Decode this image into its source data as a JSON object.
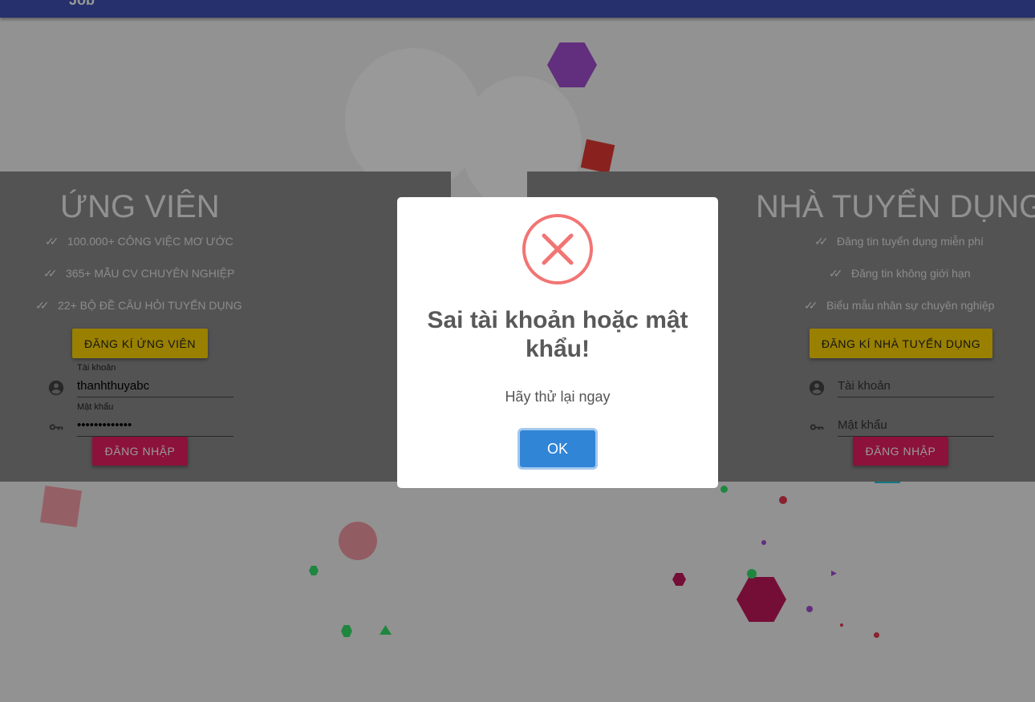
{
  "header": {
    "brand": "Job"
  },
  "candidate": {
    "title": "ỨNG VIÊN",
    "features": [
      "100.000+ CÔNG VIỆC MƠ ƯỚC",
      "365+ MẪU CV CHUYÊN NGHIỆP",
      "22+ BỘ ĐỀ CÂU HỎI TUYỂN DỤNG"
    ],
    "register_label": "ĐĂNG KÍ ỨNG VIÊN",
    "username_label": "Tài khoản",
    "username_value": "thanhthuyabc",
    "password_label": "Mật khẩu",
    "password_value": "•••••••••••••",
    "login_label": "ĐĂNG NHẬP"
  },
  "employer": {
    "title": "NHÀ TUYỂN DỤNG",
    "features": [
      "Đăng tin tuyển dụng miễn phí",
      "Đăng tin không giới hạn",
      "Biểu mẫu nhân sự chuyên nghiệp"
    ],
    "register_label": "ĐĂNG KÍ NHÀ TUYỂN DỤNG",
    "username_placeholder": "Tài khoản",
    "password_placeholder": "Mật khẩu",
    "login_label": "ĐĂNG NHẬP"
  },
  "dialog": {
    "icon": "error-x-icon",
    "title": "Sai tài khoản hoặc mật khẩu!",
    "message": "Hãy thử lại ngay",
    "ok_label": "OK"
  },
  "colors": {
    "topbar": "#3f51b5",
    "register_button": "#ffd600",
    "login_button": "#e91e63",
    "ok_button": "#3085d6",
    "error_icon": "#f27474"
  }
}
